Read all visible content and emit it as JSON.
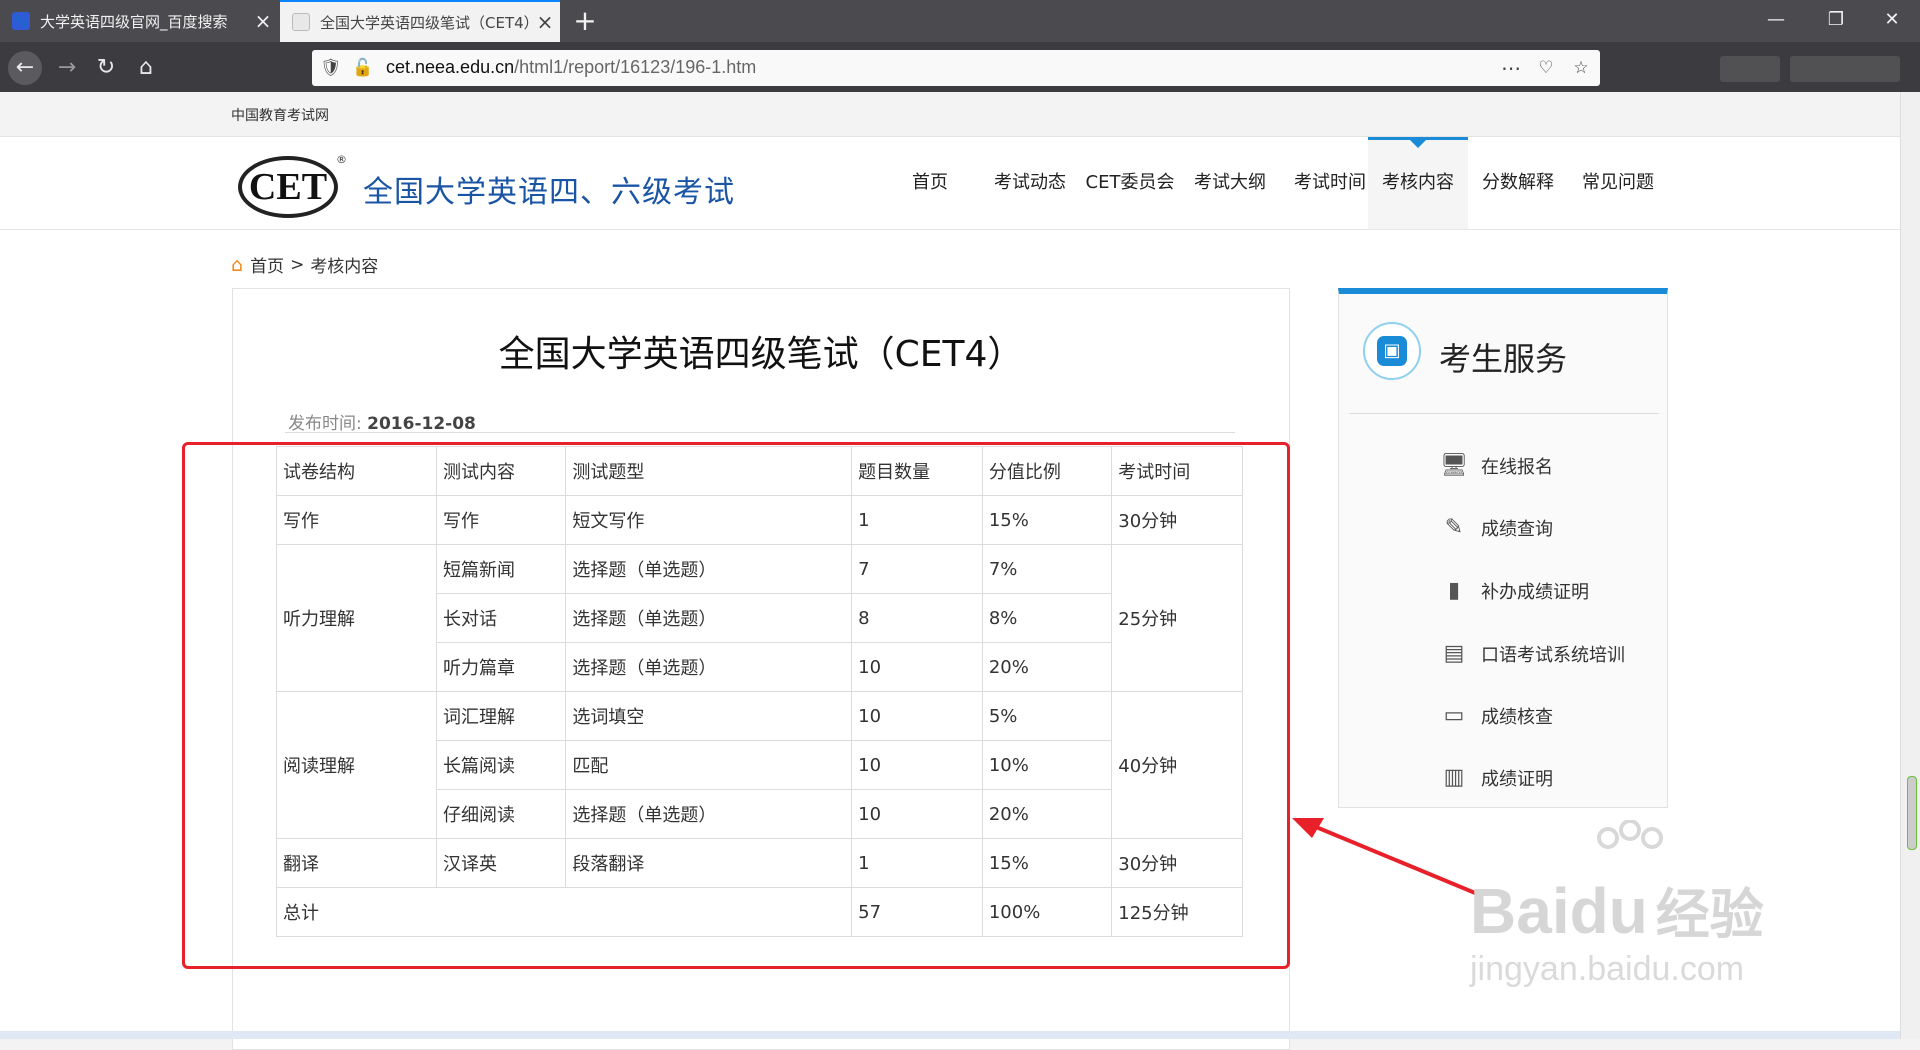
{
  "browser": {
    "tabs": [
      {
        "title": "大学英语四级官网_百度搜索"
      },
      {
        "title": "全国大学英语四级笔试（CET4）"
      }
    ],
    "new_tab": "+",
    "window_controls": {
      "minimize": "—",
      "maximize": "❐",
      "close": "✕"
    },
    "url": "cet.neea.edu.cn/html1/report/16123/196-1.htm",
    "url_domain": "cet.neea.edu.cn",
    "url_path": "/html1/report/16123/196-1.htm"
  },
  "page": {
    "top_strip": "中国教育考试网",
    "logo": "CET",
    "logo_reg": "®",
    "site_title": "全国大学英语四、六级考试",
    "nav": [
      "首页",
      "考试动态",
      "CET委员会",
      "考试大纲",
      "考试时间",
      "考核内容",
      "分数解释",
      "常见问题"
    ],
    "nav_active": "考核内容",
    "breadcrumb": {
      "home": "首页",
      "sep": ">",
      "current": "考核内容"
    },
    "article": {
      "title": "全国大学英语四级笔试（CET4）",
      "date_label": "发布时间:",
      "date": "2016-12-08",
      "table": {
        "headers": [
          "试卷结构",
          "测试内容",
          "测试题型",
          "题目数量",
          "分值比例",
          "考试时间"
        ],
        "rows": [
          [
            "写作",
            "写作",
            "短文写作",
            "1",
            "15%",
            "30分钟"
          ],
          [
            "听力理解",
            "短篇新闻",
            "选择题（单选题）",
            "7",
            "7%",
            "25分钟"
          ],
          [
            "",
            "长对话",
            "选择题（单选题）",
            "8",
            "8%",
            ""
          ],
          [
            "",
            "听力篇章",
            "选择题（单选题）",
            "10",
            "20%",
            ""
          ],
          [
            "阅读理解",
            "词汇理解",
            "选词填空",
            "10",
            "5%",
            "40分钟"
          ],
          [
            "",
            "长篇阅读",
            "匹配",
            "10",
            "10%",
            ""
          ],
          [
            "",
            "仔细阅读",
            "选择题（单选题）",
            "10",
            "20%",
            ""
          ],
          [
            "翻译",
            "汉译英",
            "段落翻译",
            "1",
            "15%",
            "30分钟"
          ]
        ],
        "total": [
          "总计",
          "57",
          "100%",
          "125分钟"
        ]
      }
    },
    "sidebar": {
      "title": "考生服务",
      "items": [
        {
          "label": "在线报名",
          "icon": "monitor-icon"
        },
        {
          "label": "成绩查询",
          "icon": "edit-icon"
        },
        {
          "label": "补办成绩证明",
          "icon": "notebook-icon"
        },
        {
          "label": "口语考试系统培训",
          "icon": "presentation-icon"
        },
        {
          "label": "成绩核查",
          "icon": "book-icon"
        },
        {
          "label": "成绩证明",
          "icon": "certificate-icon"
        }
      ]
    },
    "watermark": {
      "brand": "Bai",
      "brand2": "du",
      "text": "经验",
      "url": "jingyan.baidu.com"
    },
    "colors": {
      "accent": "#1a8bd6",
      "title_blue": "#1a55a5",
      "annotation_red": "#e8202a"
    }
  }
}
